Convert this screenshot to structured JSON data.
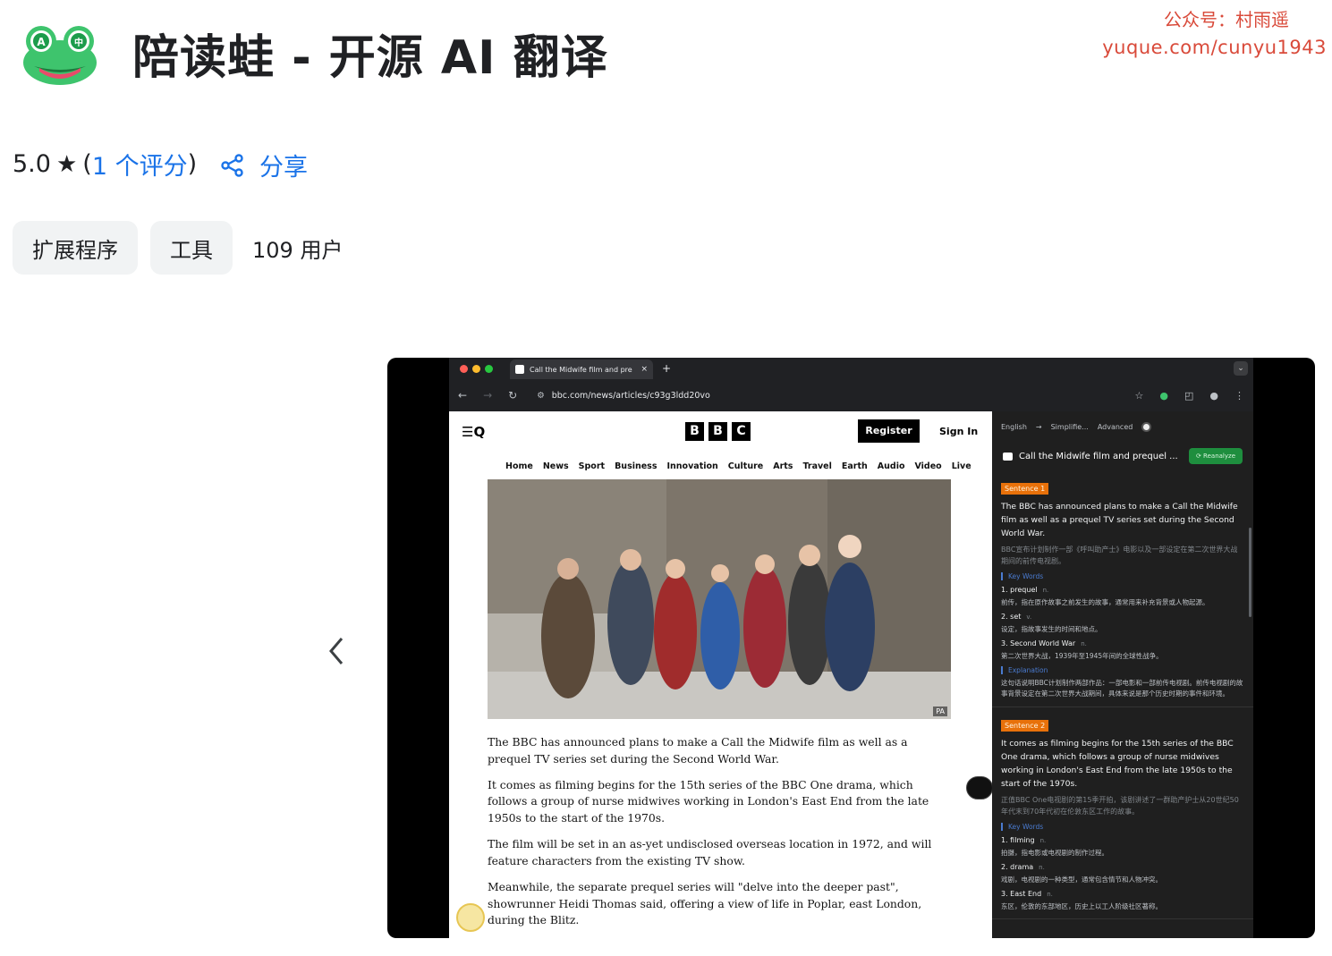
{
  "watermark": {
    "line1": "公众号：村雨遥",
    "line2": "yuque.com/cunyu1943"
  },
  "header": {
    "title": "陪读蛙 - 开源 AI 翻译"
  },
  "rating": {
    "score": "5.0",
    "star": "★",
    "open_paren": "(",
    "link": "1 个评分",
    "close_paren": ")"
  },
  "share": {
    "label": "分享"
  },
  "chips": {
    "category": "扩展程序",
    "subcategory": "工具",
    "users": "109 用户"
  },
  "screenshot": {
    "browser": {
      "tab_title": "Call the Midwife film and pre",
      "tab_close": "×",
      "new_tab": "+",
      "url": "bbc.com/news/articles/c93g3ldd20vo"
    },
    "bbc": {
      "menu": "☰Q",
      "logo": [
        "B",
        "B",
        "C"
      ],
      "register": "Register",
      "signin": "Sign In",
      "nav": [
        "Home",
        "News",
        "Sport",
        "Business",
        "Innovation",
        "Culture",
        "Arts",
        "Travel",
        "Earth",
        "Audio",
        "Video",
        "Live"
      ],
      "photo_credit": "PA",
      "paragraphs": [
        "The BBC has announced plans to make a Call the Midwife film as well as a prequel TV series set during the Second World War.",
        "It comes as filming begins for the 15th series of the BBC One drama, which follows a group of nurse midwives working in London's East End from the late 1950s to the start of the 1970s.",
        "The film will be set in an as-yet undisclosed overseas location in 1972, and will feature characters from the existing TV show.",
        "Meanwhile, the separate prequel series will \"delve into the deeper past\", showrunner Heidi Thomas said, offering a view of life in Poplar, east London, during the Blitz."
      ]
    },
    "panel": {
      "lang": "English",
      "arrow": "→",
      "mode": "Simplifie...",
      "level": "Advanced",
      "article_title": "Call the Midwife film and prequel ...",
      "reanalyze": "⟳ Reanalyze",
      "sentences": [
        {
          "badge": "Sentence 1",
          "en": "The BBC has announced plans to make a Call the Midwife film as well as a prequel TV series set during the Second World War.",
          "zh": "BBC宣布计划制作一部《呼叫助产士》电影以及一部设定在第二次世界大战期间的前传电视剧。",
          "key_words_label": "Key Words",
          "key_words": [
            {
              "word": "1. prequel",
              "pos": "n.",
              "def": "前传，指在原作故事之前发生的故事，通常用来补充背景或人物起源。"
            },
            {
              "word": "2. set",
              "pos": "v.",
              "def": "设定，指故事发生的时间和地点。"
            },
            {
              "word": "3. Second World War",
              "pos": "n.",
              "def": "第二次世界大战，1939年至1945年间的全球性战争。"
            }
          ],
          "explanation_label": "Explanation",
          "explanation": "这句话说明BBC计划制作两部作品：一部电影和一部前传电视剧。前传电视剧的故事背景设定在第二次世界大战期间，具体来说是那个历史时期的事件和环境。"
        },
        {
          "badge": "Sentence 2",
          "en": "It comes as filming begins for the 15th series of the BBC One drama, which follows a group of nurse midwives working in London's East End from the late 1950s to the start of the 1970s.",
          "zh": "正值BBC One电视剧的第15季开拍，该剧讲述了一群助产护士从20世纪50年代末到70年代初在伦敦东区工作的故事。",
          "key_words_label": "Key Words",
          "key_words": [
            {
              "word": "1. filming",
              "pos": "n.",
              "def": "拍摄，指电影或电视剧的制作过程。"
            },
            {
              "word": "2. drama",
              "pos": "n.",
              "def": "戏剧，电视剧的一种类型，通常包含情节和人物冲突。"
            },
            {
              "word": "3. East End",
              "pos": "n.",
              "def": "东区，伦敦的东部地区，历史上以工人阶级社区著称。"
            }
          ]
        }
      ]
    }
  }
}
